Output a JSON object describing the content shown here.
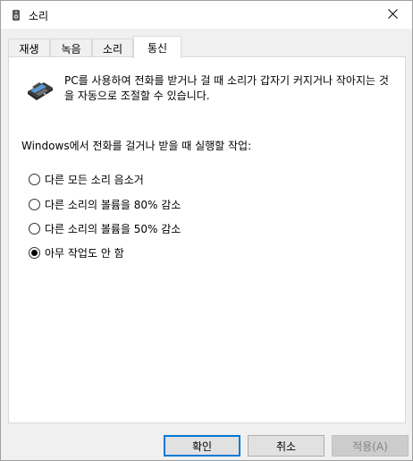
{
  "window": {
    "title": "소리",
    "title_icon": "speaker-icon",
    "close_icon": "close-icon"
  },
  "tabs": [
    {
      "label": "재생",
      "active": false
    },
    {
      "label": "녹음",
      "active": false
    },
    {
      "label": "소리",
      "active": false
    },
    {
      "label": "통신",
      "active": true
    }
  ],
  "communications": {
    "icon": "telephone-icon",
    "description": "PC를 사용하여 전화를 받거나 걸 때 소리가 갑자기 커지거나 작아지는 것을 자동으로 조절할 수 있습니다.",
    "prompt": "Windows에서 전화를 걸거나 받을 때 실행할 작업:",
    "options": [
      {
        "label": "다른 모든 소리 음소거",
        "checked": false
      },
      {
        "label": "다른 소리의 볼륨을 80% 감소",
        "checked": false
      },
      {
        "label": "다른 소리의 볼륨을 50% 감소",
        "checked": false
      },
      {
        "label": "아무 작업도 안 함",
        "checked": true
      }
    ]
  },
  "buttons": {
    "ok": "확인",
    "cancel": "취소",
    "apply": "적용(A)"
  },
  "colors": {
    "accent": "#0078d7",
    "window_bg": "#f0f0f0",
    "panel_bg": "#ffffff"
  }
}
